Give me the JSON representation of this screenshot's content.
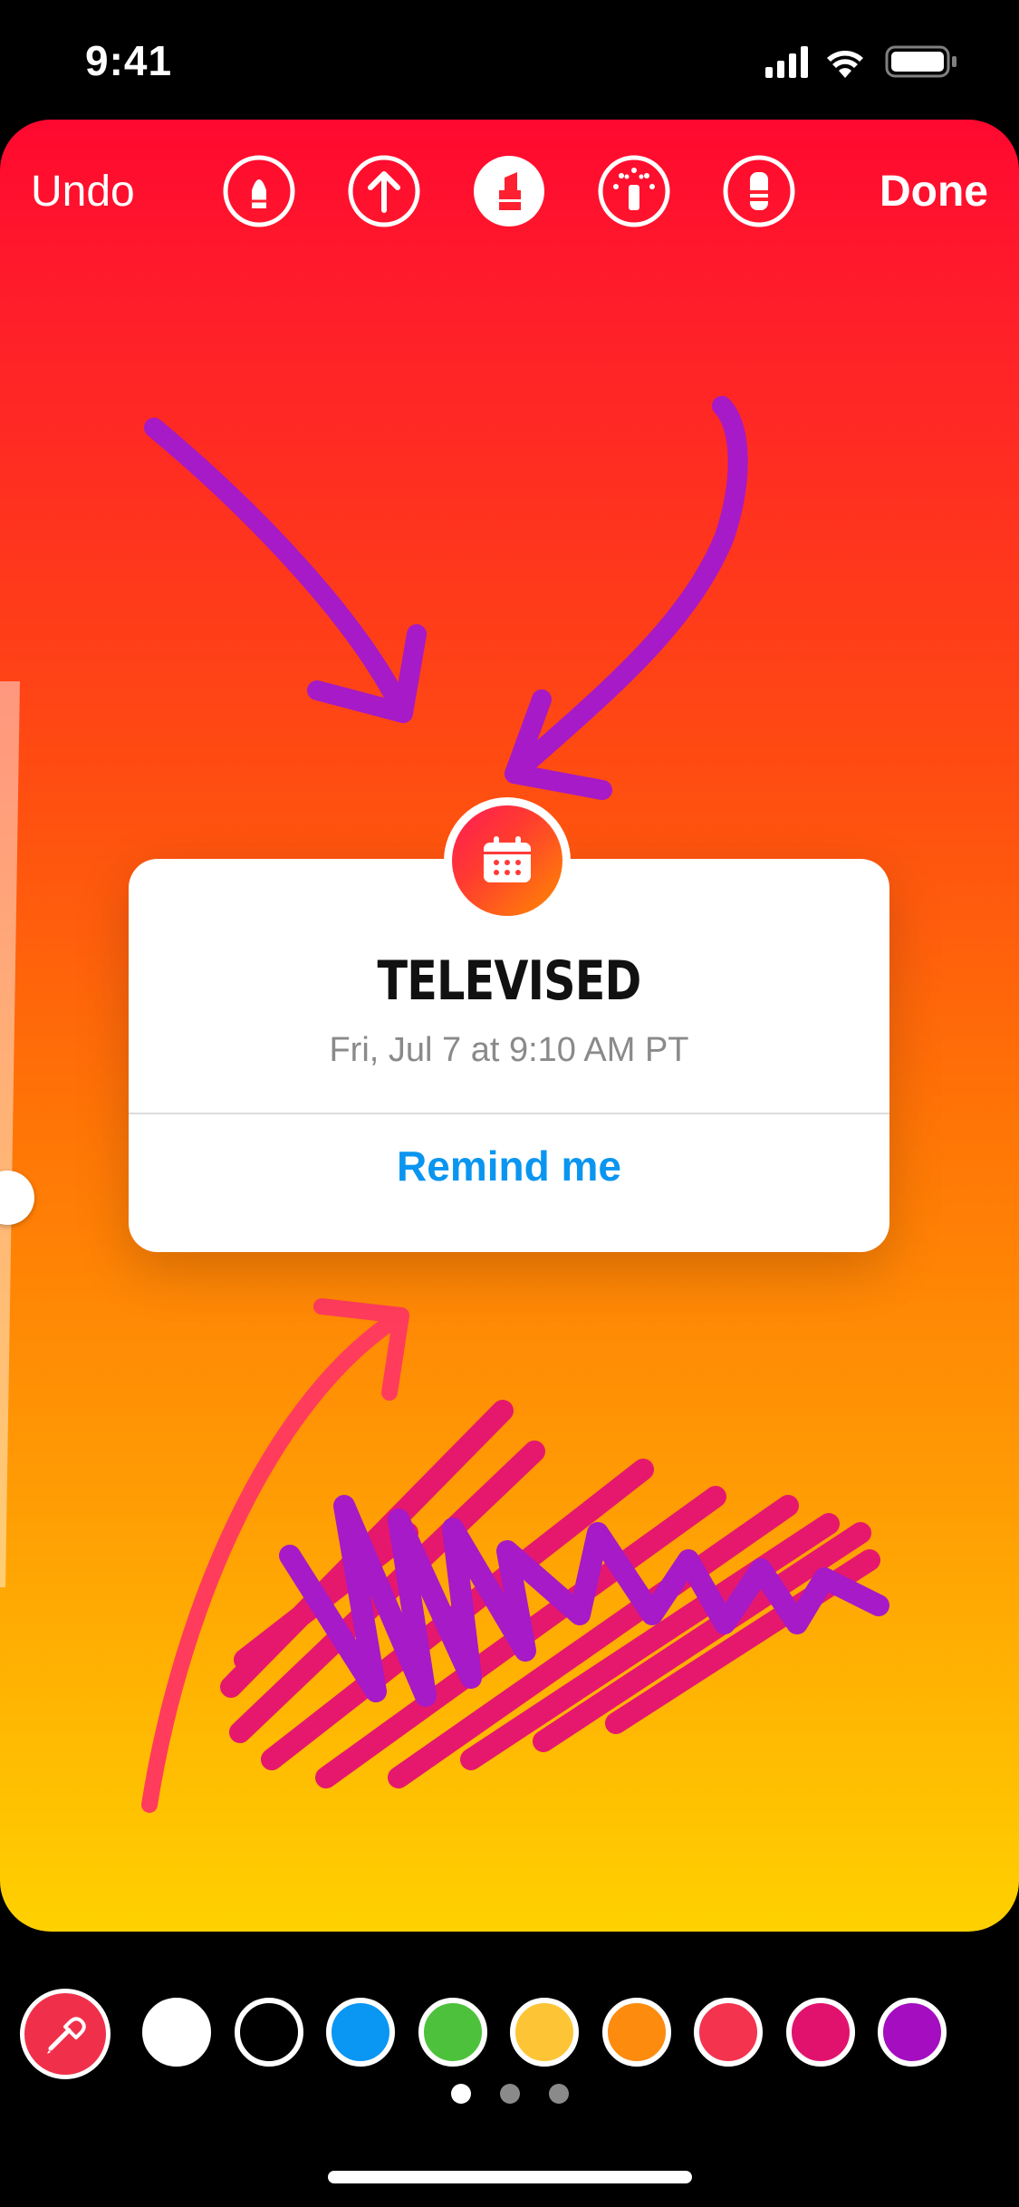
{
  "status": {
    "time": "9:41"
  },
  "toolbar": {
    "undo_label": "Undo",
    "done_label": "Done",
    "tools": [
      {
        "name": "pen-tool-icon",
        "active": false
      },
      {
        "name": "arrow-tool-icon",
        "active": false
      },
      {
        "name": "marker-tool-icon",
        "active": true
      },
      {
        "name": "neon-tool-icon",
        "active": false
      },
      {
        "name": "eraser-tool-icon",
        "active": false
      }
    ]
  },
  "sticker": {
    "title": "TELEVISED",
    "datetime": "Fri, Jul 7 at 9:10 AM PT",
    "action_label": "Remind me",
    "badge_icon": "calendar-icon"
  },
  "palette": {
    "colors": [
      "#ffffff",
      "#000000",
      "#0a96f3",
      "#4dc13b",
      "#fdc536",
      "#fd8b0e",
      "#f4344f",
      "#e1126d",
      "#a40dc0"
    ],
    "eyedropper_icon": "eyedropper-icon"
  },
  "pager": {
    "pages": 3,
    "active_index": 0
  },
  "colors": {
    "accent_blue": "#0a95f0",
    "gradient_top": "#ff0830",
    "gradient_bottom": "#ffd100"
  }
}
